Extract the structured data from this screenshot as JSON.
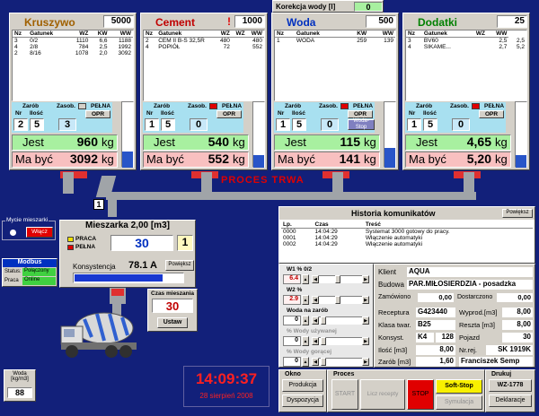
{
  "korekcja": {
    "label": "Korekcja wody [l]",
    "value": "0"
  },
  "hoppers": [
    {
      "title": "Kruszywo",
      "title_color": "#a06000",
      "flag": "",
      "capacity": "5000",
      "cols": [
        "Nz",
        "Gatunek",
        "WZ",
        "KW",
        "WW"
      ],
      "rows": [
        [
          "3",
          "0/2",
          "1110",
          "6,6",
          "1188"
        ],
        [
          "4",
          "2/8",
          "784",
          "2,5",
          "1992"
        ],
        [
          "2",
          "8/16",
          "1078",
          "2,0",
          "3092"
        ]
      ],
      "zarob_nr": "2",
      "zarob_ilosc": "5",
      "zasob": "3",
      "pelna": "",
      "opr": "OPR",
      "jest": "960",
      "mabyc": "3092",
      "unit": "kg",
      "bar": 0.25,
      "pelna_ind": "#d4d0c8"
    },
    {
      "title": "Cement",
      "title_color": "#c00000",
      "flag": "!",
      "capacity": "1000",
      "cols": [
        "Nz",
        "Gatunek",
        "WZ",
        "WZ",
        "WW"
      ],
      "rows": [
        [
          "2",
          "CEM II B-S 32,5R",
          "480",
          "",
          "480"
        ],
        [
          "4",
          "POPIÓŁ",
          "72",
          "",
          "552"
        ]
      ],
      "zarob_nr": "1",
      "zarob_ilosc": "5",
      "zasob": "0",
      "pelna": "",
      "opr": "OPR",
      "jest": "540",
      "mabyc": "552",
      "unit": "kg",
      "bar": 0.2,
      "pelna_ind": "#e00000"
    },
    {
      "title": "Woda",
      "title_color": "#0030c0",
      "flag": "",
      "capacity": "500",
      "cols": [
        "Nz",
        "Gatunek",
        "KW",
        "WW"
      ],
      "rows": [
        [
          "1",
          "WODA",
          "259",
          "139",
          "139"
        ]
      ],
      "zarob_nr": "1",
      "zarob_ilosc": "5",
      "zasob": "0",
      "pelna": "",
      "opr": "OPR",
      "jest": "115",
      "mabyc": "141",
      "unit": "kg",
      "bar": 0.3,
      "pelna_ind": "#e00000",
      "extra": "Woda-Stop"
    },
    {
      "title": "Dodatki",
      "title_color": "#008000",
      "flag": "",
      "capacity": "25",
      "cols": [
        "Nz",
        "Gatunek",
        "WZ",
        "WW"
      ],
      "rows": [
        [
          "3",
          "BV60",
          "",
          "2,5",
          "2,5"
        ],
        [
          "4",
          "SIKAME...",
          "",
          "2,7",
          "5,2"
        ]
      ],
      "zarob_nr": "1",
      "zarob_ilosc": "5",
      "zasob": "0",
      "pelna": "",
      "opr": "OPR",
      "jest": "4,65",
      "mabyc": "5,20",
      "unit": "kg",
      "bar": 0.2,
      "pelna_ind": "#e00000"
    }
  ],
  "labels": {
    "nz": "Nz",
    "gatunek": "Gatunek",
    "zarob": "Zarób",
    "zasob": "Zasob.",
    "pelna": "PEŁNA",
    "nr": "Nr",
    "ilosc": "Ilość",
    "opr": "OPR",
    "jest": "Jest",
    "mabyc": "Ma być"
  },
  "proces": "PROCES TRWA",
  "skip_num": "1",
  "mycie": {
    "title": "Mycie mieszarki",
    "btn": "Włącz"
  },
  "modbus": {
    "title": "Modbus",
    "status_lbl": "Status:",
    "status": "Połączony",
    "praca_lbl": "Praca",
    "praca": "Online"
  },
  "mieszarka": {
    "title": "Mieszarka 2,00 [m3]",
    "praca": "PRACA",
    "pelna": "PEŁNA",
    "value": "30",
    "side": "1",
    "kons_lbl": "Konsystencja",
    "kons": "78.1 A",
    "powieksz": "Powiększ"
  },
  "czas": {
    "title": "Czas mieszania",
    "value": "30",
    "btn": "Ustaw"
  },
  "woda_box": {
    "title": "Woda [kg/m3]",
    "value": "88"
  },
  "clock": {
    "time": "14:09:37",
    "date": "28 sierpień 2008"
  },
  "historia": {
    "title": "Historia komunikatów",
    "powieksz": "Powiększ",
    "cols": [
      "Lp.",
      "Czas",
      "Treść"
    ],
    "rows": [
      [
        "0000",
        "14:04:29",
        "Systemat 3000 gotowy do pracy."
      ],
      [
        "0001",
        "14:04:29",
        "Włączenie automatyki"
      ],
      [
        "0002",
        "14:04:29",
        "Włączenie automatyki"
      ]
    ]
  },
  "sliders": [
    {
      "label": "W1 % 0/2",
      "value": "6.4"
    },
    {
      "label": "W2 %",
      "value": "2.9"
    },
    {
      "label": "Woda na zarób",
      "value": "0"
    },
    {
      "label": "% Wody używanej",
      "value": "0"
    },
    {
      "label": "% Wody gorącej",
      "value": "0"
    }
  ],
  "info": {
    "klient_lbl": "Klient",
    "klient": "AQUA",
    "budowa_lbl": "Budowa",
    "budowa": "PAR.MIŁOSIERDZIA - posadzka",
    "zamowiono_lbl": "Zamówiono",
    "zamowiono": "0,00",
    "dostarczono_lbl": "Dostarczono",
    "dostarczono": "0,00",
    "receptura_lbl": "Receptura",
    "receptura": "G423440",
    "wyprod_lbl": "Wyprod.[m3]",
    "wyprod": "8,00",
    "klasa_lbl": "Klasa twar.",
    "klasa": "B25",
    "reszta_lbl": "Reszta [m3]",
    "reszta": "8,00",
    "konsyst_lbl": "Konsyst.",
    "konsyst1": "K4",
    "konsyst2": "128",
    "pojazd_lbl": "Pojazd",
    "pojazd": "30",
    "ilosc_lbl": "Ilość [m3]",
    "ilosc": "8,00",
    "nrrej_lbl": "Nr.rej.",
    "nrrej": "SK 1919K",
    "zarob_lbl": "Zarób [m3]",
    "zarob": "1,60",
    "kierowca": "Franciszek Semp"
  },
  "okno": {
    "title": "Okno",
    "produkcja": "Produkcja",
    "dyspozycja": "Dyspozycja"
  },
  "procbox": {
    "title": "Proces",
    "start": "START",
    "licz": "Licz recepty",
    "stop": "STOP",
    "softstop": "Soft-Stop",
    "symulacja": "Symulacja"
  },
  "druk": {
    "title": "Drukuj",
    "wz": "WZ-1778",
    "deklaracje": "Deklaracje"
  }
}
